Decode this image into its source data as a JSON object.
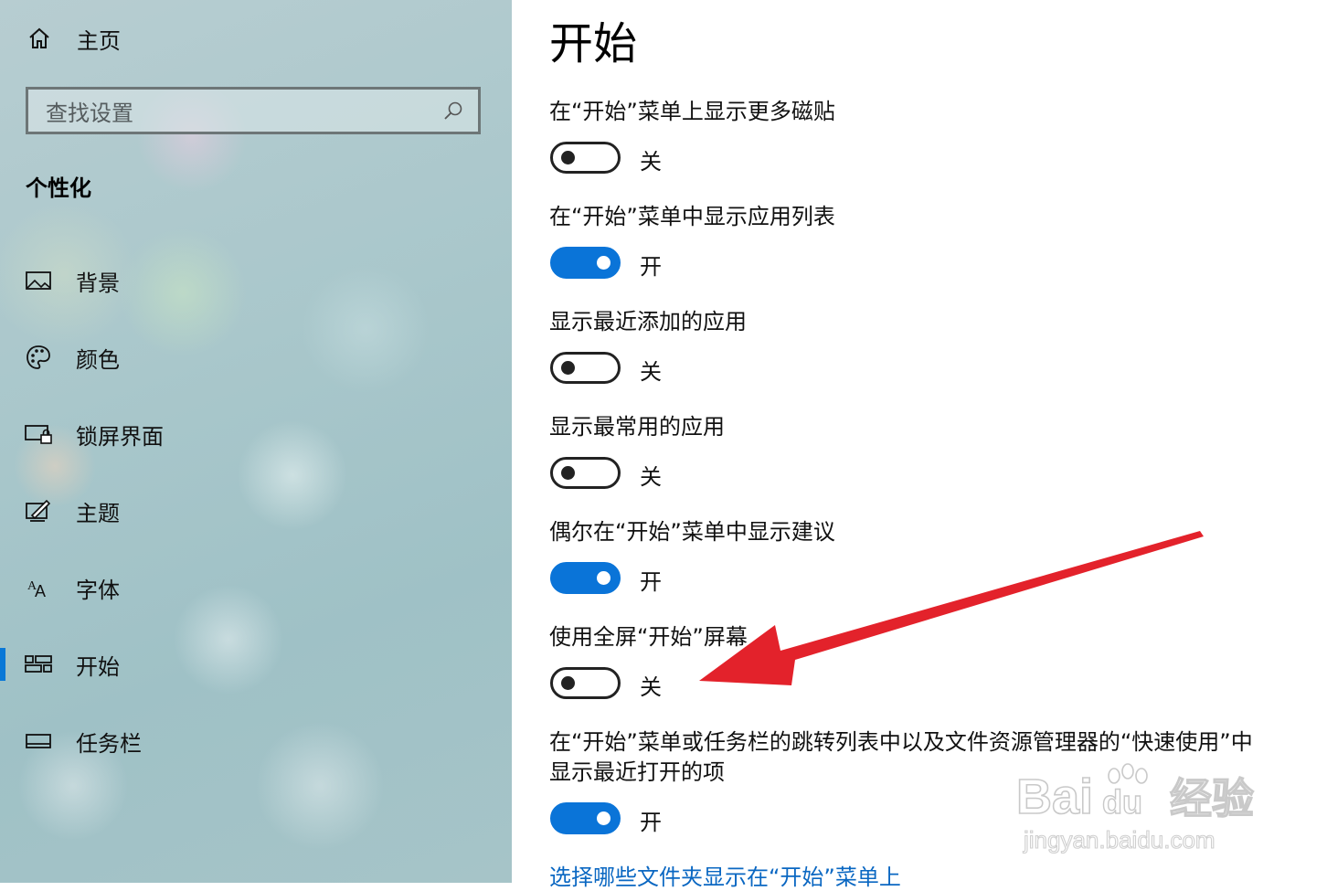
{
  "sidebar": {
    "home_label": "主页",
    "search_placeholder": "查找设置",
    "section_title": "个性化",
    "items": [
      {
        "label": "背景",
        "icon": "picture-icon"
      },
      {
        "label": "颜色",
        "icon": "palette-icon"
      },
      {
        "label": "锁屏界面",
        "icon": "lock-screen-icon"
      },
      {
        "label": "主题",
        "icon": "theme-brush-icon"
      },
      {
        "label": "字体",
        "icon": "font-icon"
      },
      {
        "label": "开始",
        "icon": "start-tiles-icon",
        "selected": true
      },
      {
        "label": "任务栏",
        "icon": "taskbar-icon"
      }
    ]
  },
  "main": {
    "title": "开始",
    "settings": [
      {
        "label": "在“开始”菜单上显示更多磁贴",
        "state": "关",
        "on": false
      },
      {
        "label": "在“开始”菜单中显示应用列表",
        "state": "开",
        "on": true
      },
      {
        "label": "显示最近添加的应用",
        "state": "关",
        "on": false
      },
      {
        "label": "显示最常用的应用",
        "state": "关",
        "on": false
      },
      {
        "label": "偶尔在“开始”菜单中显示建议",
        "state": "开",
        "on": true
      },
      {
        "label": "使用全屏“开始”屏幕",
        "state": "关",
        "on": false
      },
      {
        "label_line1": "在“开始”菜单或任务栏的跳转列表中以及文件资源管理器的“快速使用”中",
        "label_line2": "显示最近打开的项",
        "state": "开",
        "on": true
      }
    ],
    "link": "选择哪些文件夹显示在“开始”菜单上"
  },
  "watermark": {
    "brand": "Bai",
    "brand2": "du",
    "product": "经验",
    "url": "jingyan.baidu.com"
  },
  "colors": {
    "accent": "#0a74d8",
    "annotation_arrow": "#e3222b",
    "link": "#0a67c2"
  }
}
